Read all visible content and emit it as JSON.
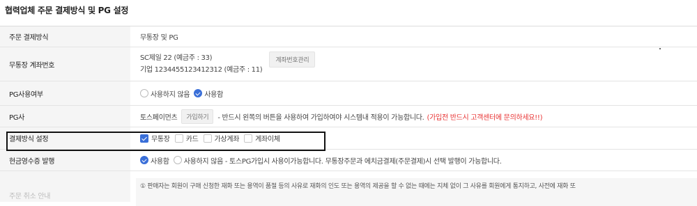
{
  "page_title": "협력업체 주문 결제방식 및 PG 설정",
  "rows": {
    "payment_method": {
      "label": "주문 결제방식",
      "value": "무통장 및 PG"
    },
    "bank_account": {
      "label": "무통장 계좌번호",
      "line1": "SC제일 22 (예금주 : 33)",
      "line2": "기업 1234455123412312 (예금주 : 11)",
      "manage_button": "계좌번호관리"
    },
    "pg_use": {
      "label": "PG사용여부",
      "opt_off": "사용하지 않음",
      "opt_on": "사용함",
      "selected": "사용함"
    },
    "pg_company": {
      "label": "PG사",
      "name": "토스페이먼츠",
      "join_button": "가입하기",
      "description": "- 반드시 왼쪽의 버튼을 사용하여 가입하여야 시스템내 적용이 가능합니다.",
      "warning": "(가입전 반드시 고객센터에 문의하세요!!)"
    },
    "payment_settings": {
      "label": "결제방식 설정",
      "options": [
        {
          "label": "무통장",
          "checked": true
        },
        {
          "label": "카드",
          "checked": false
        },
        {
          "label": "가상계좌",
          "checked": false
        },
        {
          "label": "계좌이체",
          "checked": false
        }
      ]
    },
    "cash_receipt": {
      "label": "현금영수증 발행",
      "opt_on": "사용함",
      "opt_off": "사용하지 않음 - 토스PG가입시 사용이가능합니다. 무통장주문과 에치금결제(주문결제)시 선택 발행이 가능합니다.",
      "selected": "사용함"
    },
    "notice": {
      "label": "주문 취소 안내",
      "text": "① 판매자는 회원이 구매 신청한 재화 또는 용역이 품절 등의 사유로 재화의 인도 또는 용역의 제공을 할 수 없는 때에는 지체 없이 그 사유를 회원에게 통지하고, 사전에 재화 또"
    }
  },
  "colors": {
    "accent": "#3a6fd8",
    "warning": "#e83232",
    "label_bg": "#f5f5f5"
  }
}
